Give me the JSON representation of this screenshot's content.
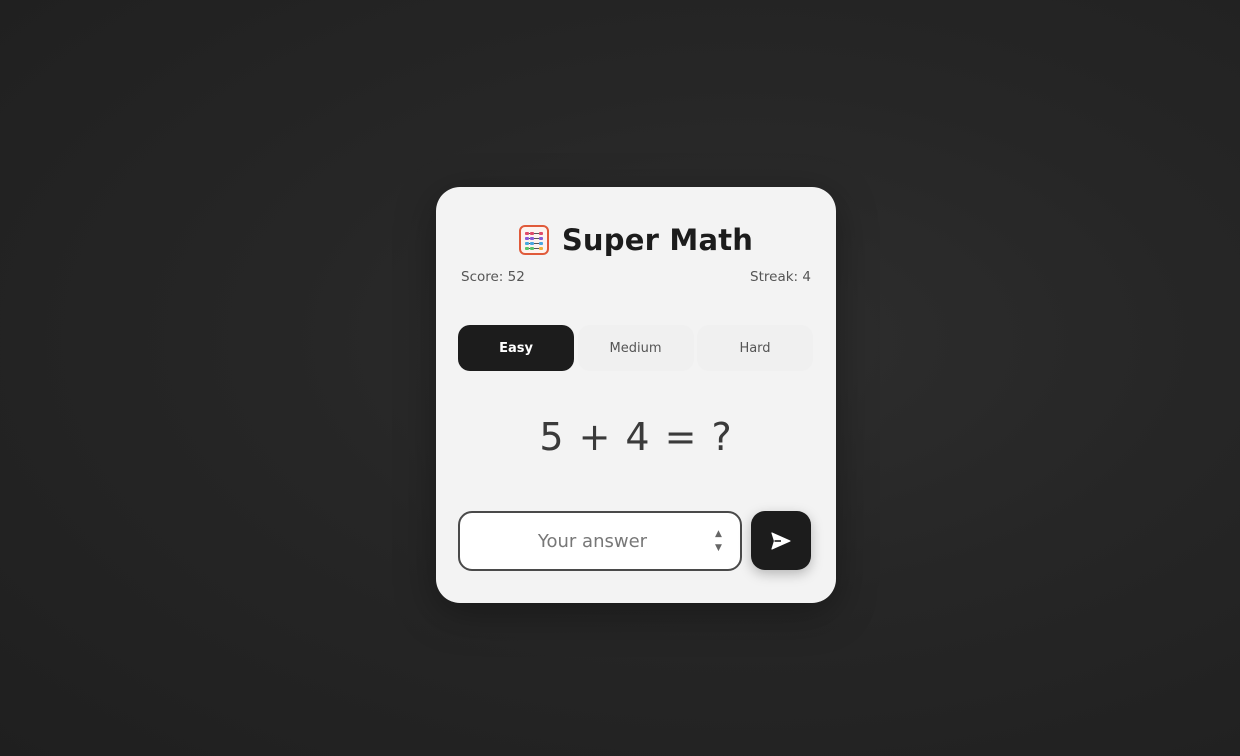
{
  "app": {
    "title": "Super Math",
    "icon": "abacus-icon"
  },
  "stats": {
    "score_label": "Score: 52",
    "streak_label": "Streak: 4"
  },
  "difficulty": {
    "options": [
      "Easy",
      "Medium",
      "Hard"
    ],
    "selected": "Easy"
  },
  "problem": {
    "operand_a": "5",
    "operator": "+",
    "operand_b": "4",
    "equals": "=",
    "unknown": "?"
  },
  "answer": {
    "value": "",
    "placeholder": "Your answer"
  },
  "submit": {
    "icon": "send-icon"
  },
  "colors": {
    "card_bg": "#f3f3f3",
    "accent_dark": "#1c1c1c",
    "page_bg": "#262626"
  }
}
